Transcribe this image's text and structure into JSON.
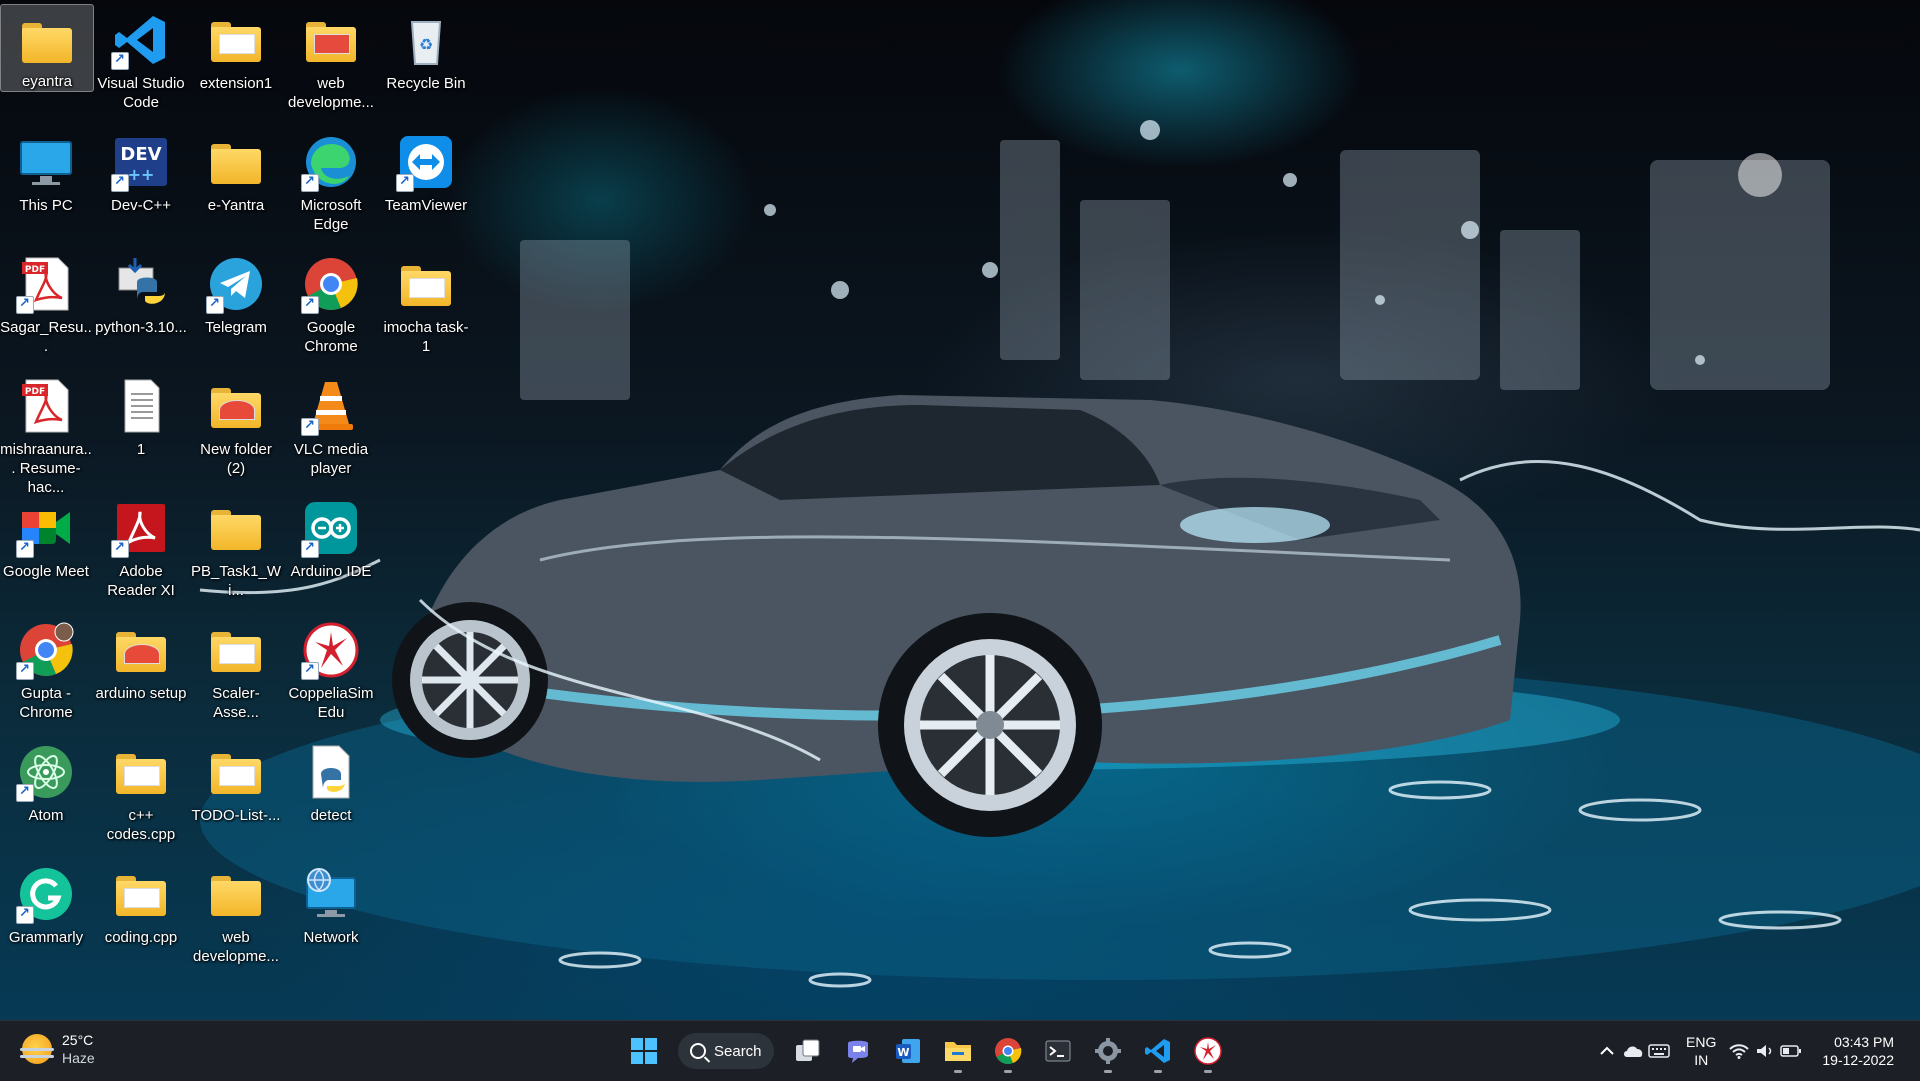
{
  "desktop": {
    "icons": [
      {
        "label": "eyantra",
        "icon": "folder-icon"
      },
      {
        "label": "Visual Studio Code",
        "icon": "vscode-icon"
      },
      {
        "label": "extension1",
        "icon": "folder-icon"
      },
      {
        "label": "web developme...",
        "icon": "folder-icon"
      },
      {
        "label": "Recycle Bin",
        "icon": "recycle-bin-icon"
      },
      {
        "label": "This PC",
        "icon": "monitor-icon"
      },
      {
        "label": "Dev-C++",
        "icon": "devcpp-icon"
      },
      {
        "label": "e-Yantra",
        "icon": "folder-icon"
      },
      {
        "label": "Microsoft Edge",
        "icon": "edge-icon"
      },
      {
        "label": "TeamViewer",
        "icon": "teamviewer-icon"
      },
      {
        "label": "Sagar_Resu...",
        "icon": "pdf-icon"
      },
      {
        "label": "python-3.10...",
        "icon": "python-installer-icon"
      },
      {
        "label": "Telegram",
        "icon": "telegram-icon"
      },
      {
        "label": "Google Chrome",
        "icon": "chrome-icon"
      },
      {
        "label": "imocha task-1",
        "icon": "folder-icon"
      },
      {
        "label": "mishraanura... Resume-hac...",
        "icon": "pdf-icon"
      },
      {
        "label": "1",
        "icon": "text-file-icon"
      },
      {
        "label": "New folder (2)",
        "icon": "folder-icon"
      },
      {
        "label": "VLC media player",
        "icon": "vlc-icon"
      },
      {
        "label": "Google Meet",
        "icon": "google-meet-icon"
      },
      {
        "label": "Adobe Reader XI",
        "icon": "adobe-reader-icon"
      },
      {
        "label": "PB_Task1_Wi...",
        "icon": "folder-icon"
      },
      {
        "label": "Arduino IDE",
        "icon": "arduino-icon"
      },
      {
        "label": "Gupta - Chrome",
        "icon": "chrome-icon"
      },
      {
        "label": "arduino setup",
        "icon": "folder-icon"
      },
      {
        "label": "Scaler-Asse...",
        "icon": "folder-icon"
      },
      {
        "label": "CoppeliaSim Edu",
        "icon": "coppeliasim-icon"
      },
      {
        "label": "Atom",
        "icon": "atom-icon"
      },
      {
        "label": "c++ codes.cpp",
        "icon": "folder-icon"
      },
      {
        "label": "TODO-List-...",
        "icon": "folder-icon"
      },
      {
        "label": "detect",
        "icon": "python-file-icon"
      },
      {
        "label": "Grammarly",
        "icon": "grammarly-icon"
      },
      {
        "label": "coding.cpp",
        "icon": "folder-icon"
      },
      {
        "label": "web developme...",
        "icon": "folder-icon"
      },
      {
        "label": "Network",
        "icon": "network-icon"
      }
    ]
  },
  "taskbar": {
    "weather": {
      "temp": "25°C",
      "condition": "Haze"
    },
    "search_label": "Search",
    "pinned": [
      "task-view-icon",
      "teams-chat-icon",
      "word-icon",
      "file-explorer-icon",
      "chrome-icon",
      "terminal-icon",
      "settings-icon",
      "vscode-icon",
      "app-icon"
    ],
    "tray": {
      "lang_top": "ENG",
      "lang_bottom": "IN",
      "time": "03:43 PM",
      "date": "19-12-2022"
    }
  },
  "colors": {
    "taskbar": "#1c2026",
    "accent": "#0078d4",
    "folder": "#f2b629"
  }
}
